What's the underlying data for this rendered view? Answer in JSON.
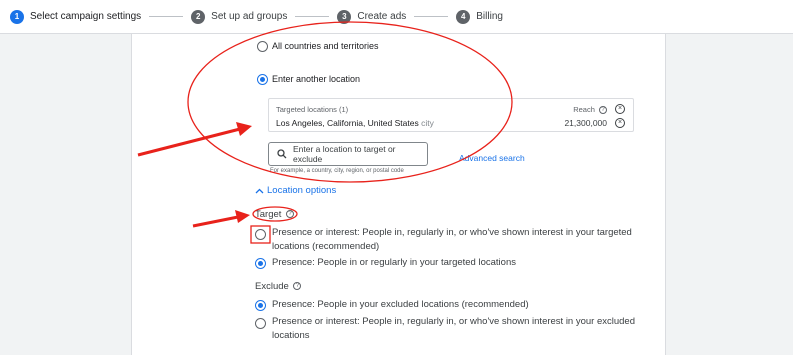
{
  "stepper": {
    "steps": [
      {
        "num": "1",
        "label": "Select campaign settings"
      },
      {
        "num": "2",
        "label": "Set up ad groups"
      },
      {
        "num": "3",
        "label": "Create ads"
      },
      {
        "num": "4",
        "label": "Billing"
      }
    ]
  },
  "locations": {
    "opt_all": "All countries and territories",
    "opt_another": "Enter another location",
    "targeted_header": "Targeted locations (1)",
    "reach_header": "Reach",
    "location_name": "Los Angeles, California, United States",
    "location_type": "city",
    "reach_value": "21,300,000",
    "search_placeholder": "Enter a location to target or exclude",
    "advanced_search": "Advanced search",
    "search_hint": "For example, a country, city, region, or postal code"
  },
  "location_options": {
    "toggle_label": "Location options",
    "target_heading": "Target",
    "target_opt1_line1": "Presence or interest: People in, regularly in, or who've shown interest in your targeted",
    "target_opt1_line2": "locations (recommended)",
    "target_opt2": "Presence: People in or regularly in your targeted locations",
    "exclude_heading": "Exclude",
    "exclude_opt1": "Presence: People in your excluded locations (recommended)",
    "exclude_opt2_line1": "Presence or interest: People in, regularly in, or who've shown interest in your excluded",
    "exclude_opt2_line2": "locations"
  },
  "colors": {
    "accent": "#1a73e8",
    "annotation": "#e8221b"
  }
}
